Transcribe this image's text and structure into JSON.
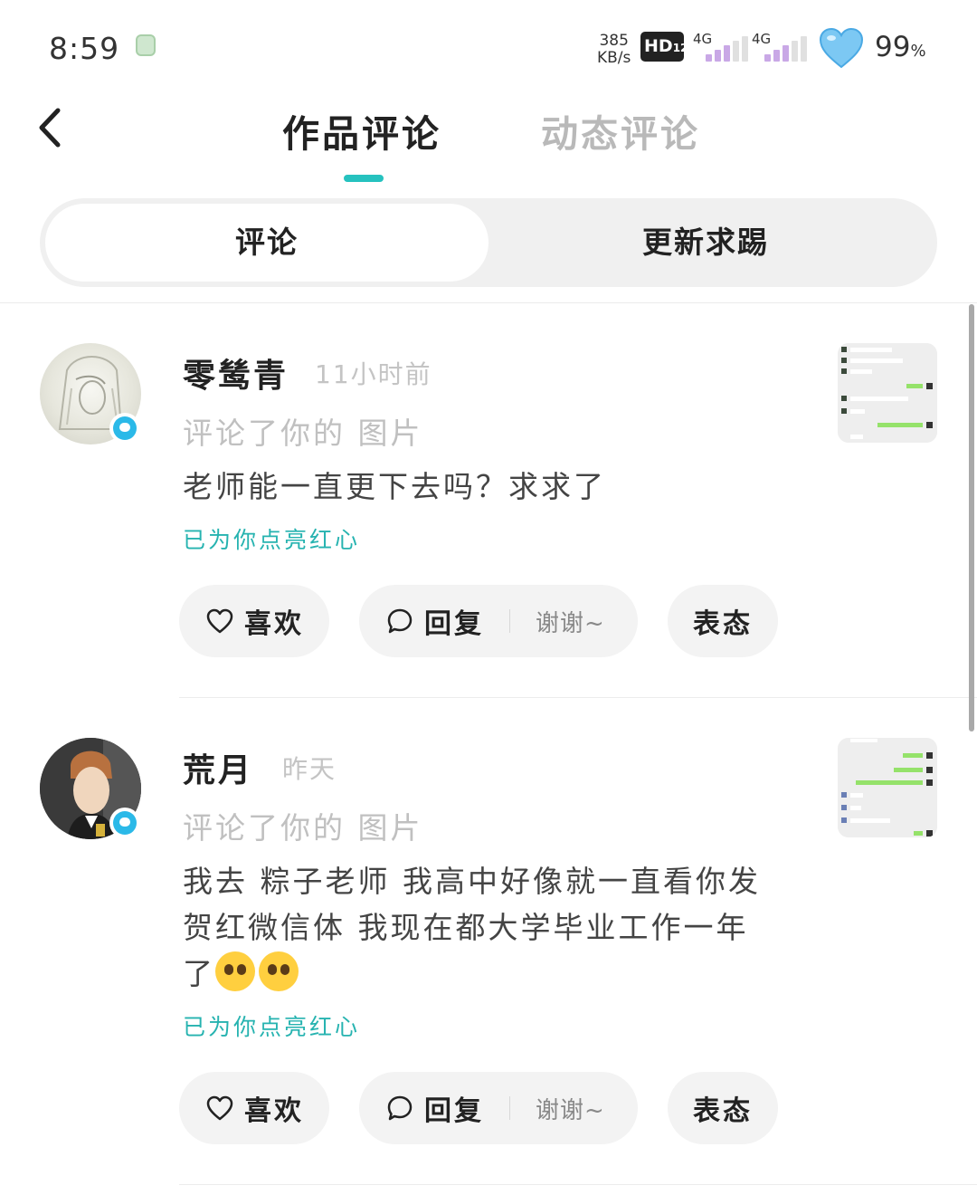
{
  "status_bar": {
    "time": "8:59",
    "net_speed_value": "385",
    "net_speed_unit": "KB/s",
    "hd_label": "HD",
    "hd_sub": "12",
    "signal1_label": "4G",
    "signal2_label": "4G",
    "battery": "99",
    "battery_unit": "%"
  },
  "header": {
    "tabs": [
      {
        "label": "作品评论",
        "active": true
      },
      {
        "label": "动态评论",
        "active": false
      }
    ],
    "accent_color": "#26c2bf"
  },
  "segmented": {
    "options": [
      {
        "label": "评论",
        "active": true
      },
      {
        "label": "更新求踢",
        "active": false
      }
    ]
  },
  "comments": [
    {
      "user": "零鸶青",
      "time": "11小时前",
      "action": "评论了你的 图片",
      "text": "老师能一直更下去吗？求求了",
      "liked_note": "已为你点亮红心",
      "like_label": "喜欢",
      "reply_label": "回复",
      "reply_hint": "谢谢~",
      "react_label": "表态"
    },
    {
      "user": "荒月",
      "time": "昨天",
      "action": "评论了你的 图片",
      "text_line1": "我去 粽子老师 我高中好像就一直看你发",
      "text_line2": "贺红微信体 我现在都大学毕业工作一年",
      "text_line3": "了",
      "liked_note": "已为你点亮红心",
      "like_label": "喜欢",
      "reply_label": "回复",
      "reply_hint": "谢谢~",
      "react_label": "表态"
    }
  ]
}
